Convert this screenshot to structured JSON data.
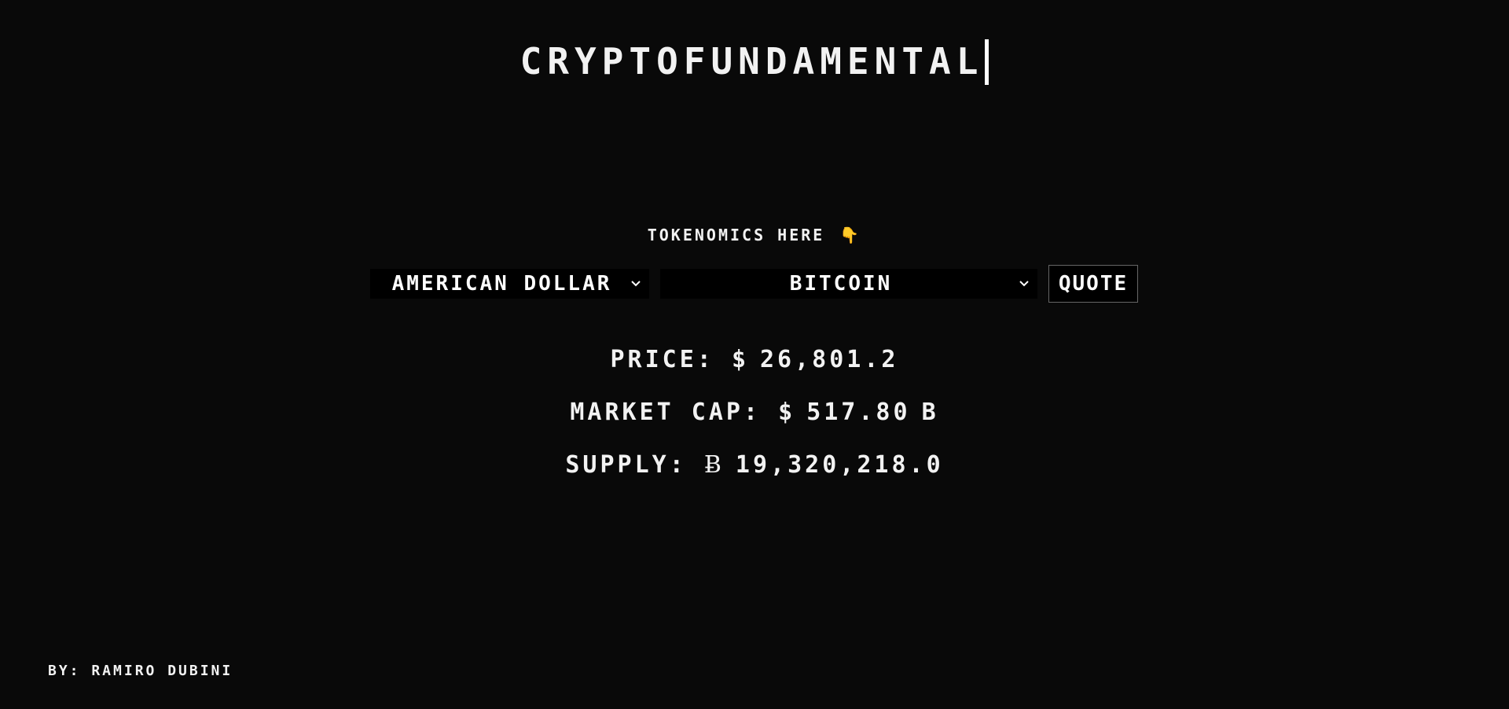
{
  "header": {
    "title": "CRYPTOFUNDAMENTAL"
  },
  "prompt": {
    "text": "TOKENOMICS HERE",
    "icon": "point-down-icon",
    "icon_glyph": "👇",
    "icon_color": "#f4b43a"
  },
  "controls": {
    "fiat_select": {
      "selected": "AMERICAN DOLLAR"
    },
    "crypto_select": {
      "selected": "BITCOIN"
    },
    "quote_button": {
      "label": "QUOTE"
    }
  },
  "stats": {
    "price": {
      "label": "PRICE:",
      "symbol": "$",
      "value": "26,801.2"
    },
    "market_cap": {
      "label": "MARKET CAP:",
      "symbol": "$",
      "value": "517.80",
      "unit": "B"
    },
    "supply": {
      "label": "SUPPLY:",
      "symbol": "Ƀ",
      "value": "19,320,218.0"
    }
  },
  "footer": {
    "credit": "BY: RAMIRO DUBINI"
  },
  "colors": {
    "background": "#090909",
    "text": "#f2f2f2",
    "control_background": "#000000",
    "button_border": "#666666"
  }
}
